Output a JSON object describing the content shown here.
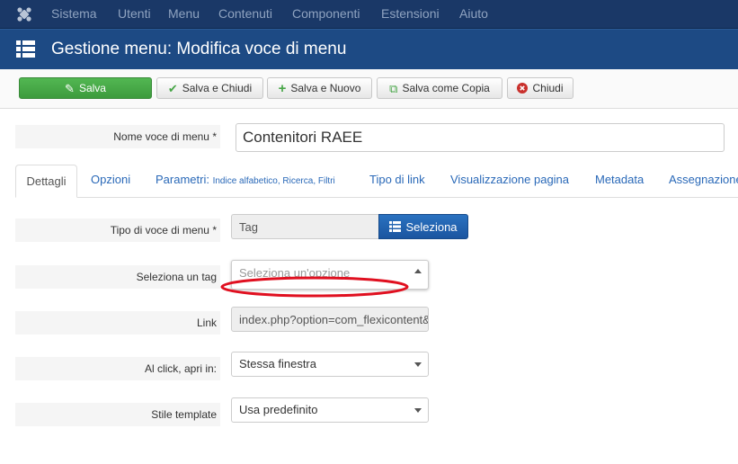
{
  "topmenu": {
    "items": [
      "Sistema",
      "Utenti",
      "Menu",
      "Contenuti",
      "Componenti",
      "Estensioni",
      "Aiuto"
    ]
  },
  "header": {
    "title": "Gestione menu: Modifica voce di menu"
  },
  "toolbar": {
    "save": "Salva",
    "save_close": "Salva e Chiudi",
    "save_new": "Salva e Nuovo",
    "save_copy": "Salva come Copia",
    "close": "Chiudi"
  },
  "form": {
    "name_label": "Nome voce di menu *",
    "name_value": "Contenitori RAEE"
  },
  "tabs": {
    "details": "Dettagli",
    "options": "Opzioni",
    "params": "Parametri:",
    "params_sub": "Indice alfabetico, Ricerca, Filtri",
    "link_type": "Tipo di link",
    "page_display": "Visualizzazione pagina",
    "metadata": "Metadata",
    "assignment": "Assegnazione"
  },
  "details": {
    "type_label": "Tipo di voce di menu *",
    "type_value": "Tag",
    "select_button": "Seleziona",
    "tag_label": "Seleziona un tag",
    "tag_placeholder": "Seleziona un'opzione",
    "link_label": "Link",
    "link_value": "index.php?option=com_flexicontent&",
    "target_label": "Al click, apri in:",
    "target_value": "Stessa finestra",
    "template_label": "Stile template",
    "template_value": "Usa predefinito"
  },
  "colors": {
    "topbar": "#1a3867",
    "titlebar": "#1d4a84",
    "save_green": "#46a546",
    "select_blue": "#2a72c0",
    "highlight_red": "#e01020"
  }
}
